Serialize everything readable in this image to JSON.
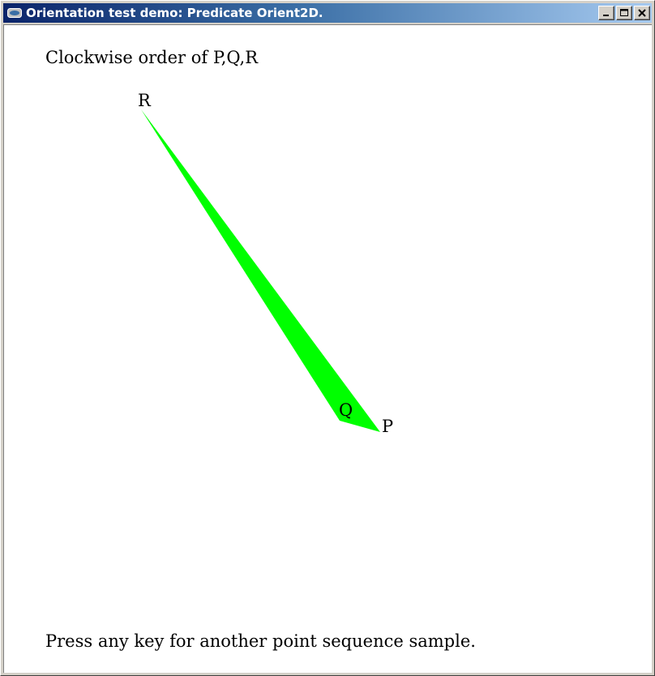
{
  "window": {
    "title": "Orientation test demo: Predicate Orient2D."
  },
  "caption_buttons": [
    {
      "name": "minimize-button",
      "icon": "minimize-icon"
    },
    {
      "name": "maximize-button",
      "icon": "maximize-icon"
    },
    {
      "name": "close-button",
      "icon": "close-icon"
    }
  ],
  "canvas": {
    "status_text": "Clockwise order of P,Q,R",
    "footer_text": "Press any key for another point sequence sample.",
    "fill_color": "#00ff00",
    "points": [
      {
        "label": "P"
      },
      {
        "label": "Q"
      },
      {
        "label": "R"
      }
    ]
  }
}
